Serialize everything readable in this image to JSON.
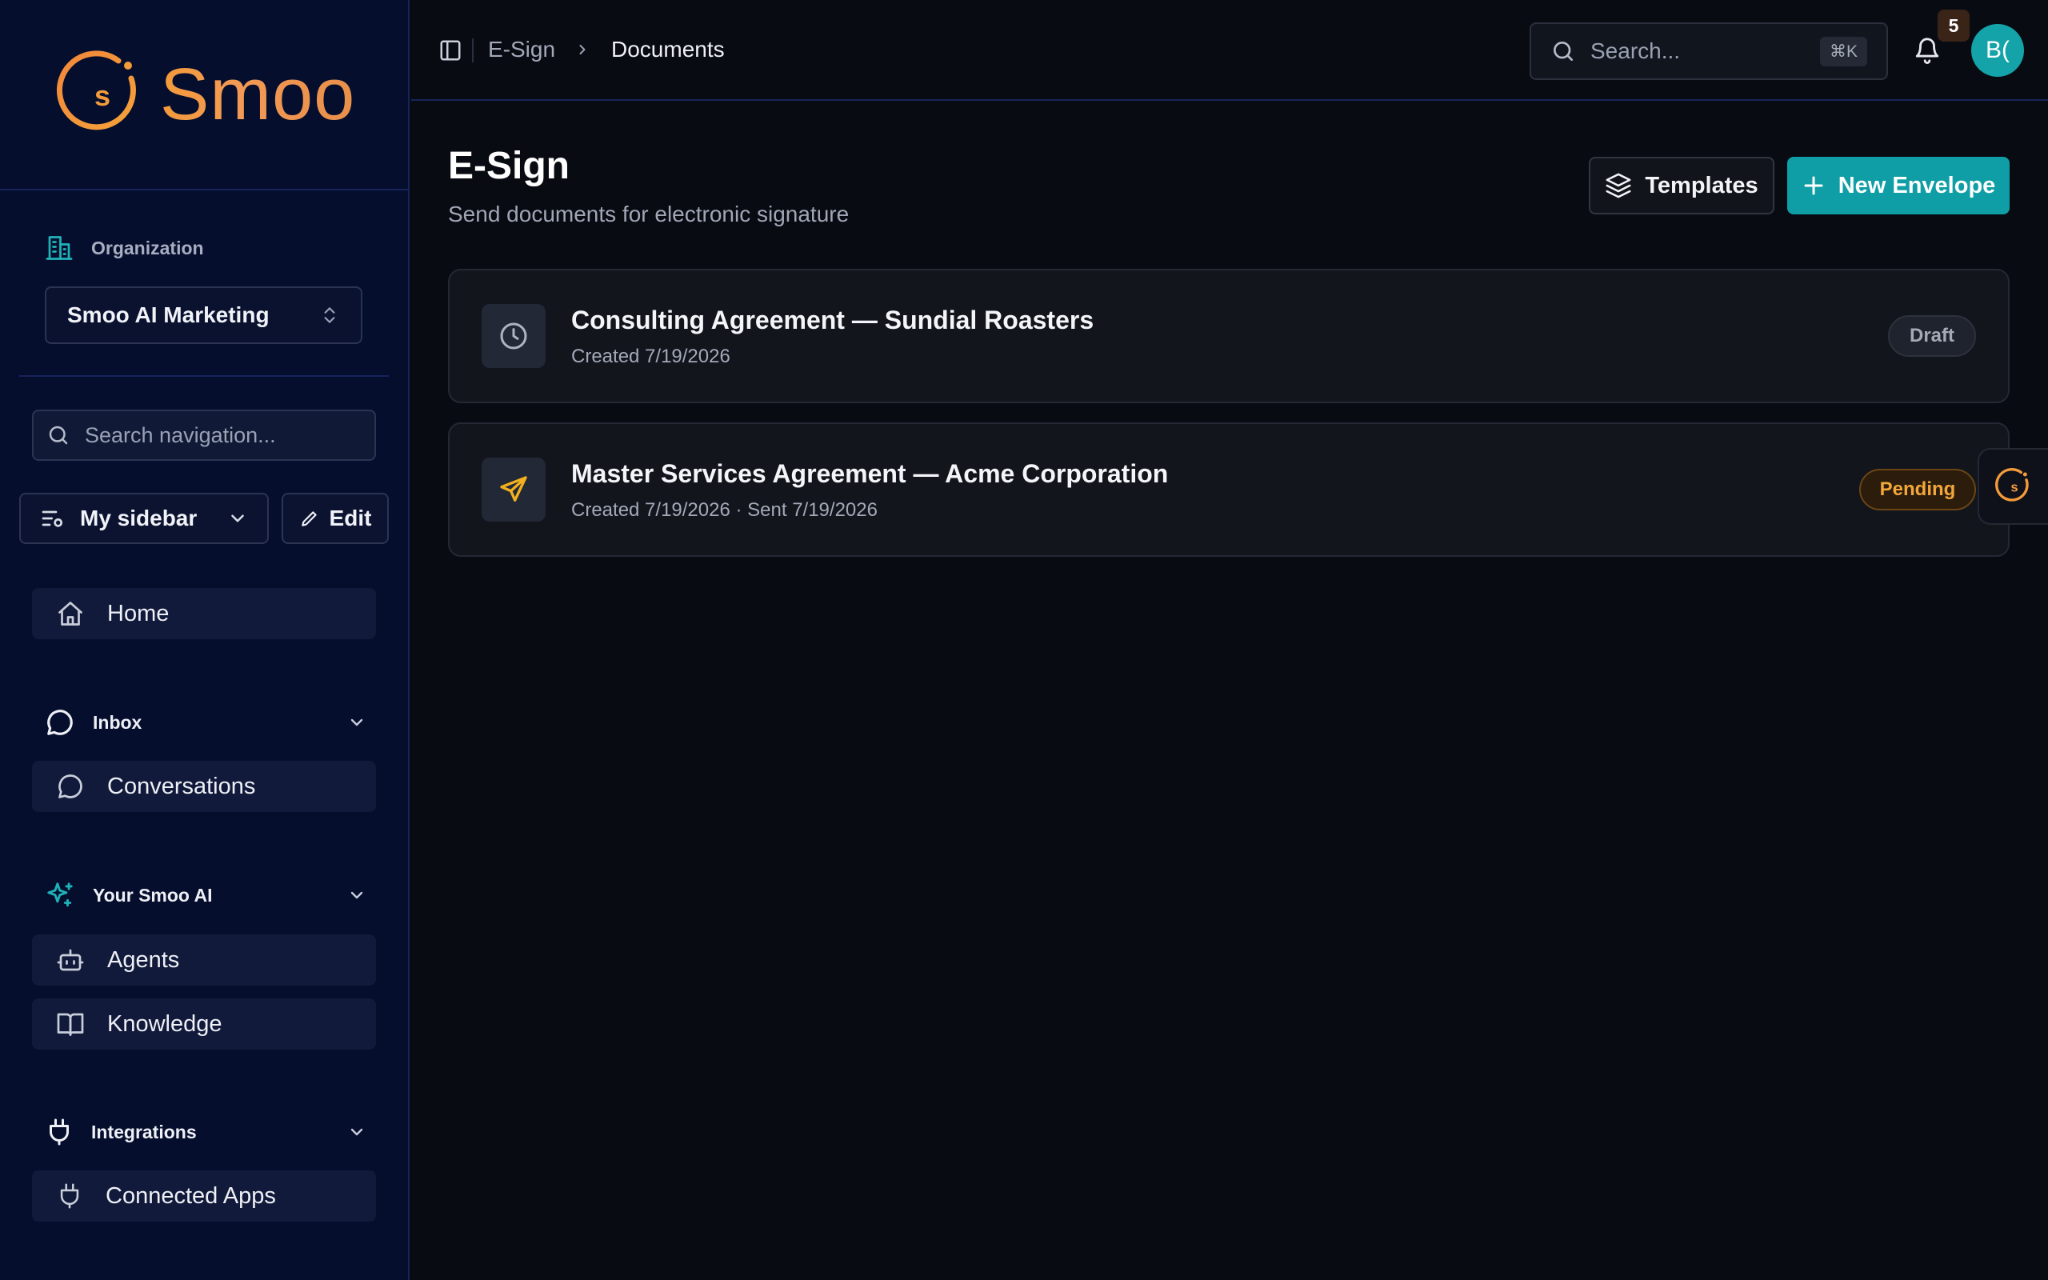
{
  "sidebar": {
    "logo_text": "Smoo",
    "organization_label": "Organization",
    "organization_name": "Smoo AI Marketing",
    "search_placeholder": "Search navigation...",
    "sidebar_view": "My sidebar",
    "edit_label": "Edit",
    "home_label": "Home",
    "sections": [
      {
        "label": "Inbox",
        "items": [
          "Conversations"
        ]
      },
      {
        "label": "Your Smoo AI",
        "items": [
          "Agents",
          "Knowledge"
        ]
      },
      {
        "label": "Integrations",
        "items": [
          "Connected Apps"
        ]
      }
    ]
  },
  "topbar": {
    "breadcrumb": [
      "E-Sign",
      "Documents"
    ],
    "search_placeholder": "Search...",
    "search_shortcut": "⌘K",
    "notification_count": "5",
    "avatar_initials": "B("
  },
  "main": {
    "title": "E-Sign",
    "subtitle": "Send documents for electronic signature",
    "templates_label": "Templates",
    "new_envelope_label": "New Envelope",
    "documents": [
      {
        "title": "Consulting Agreement — Sundial Roasters",
        "meta": "Created 7/19/2026",
        "status": "Draft",
        "icon": "clock-icon"
      },
      {
        "title": "Master Services Agreement — Acme Corporation",
        "meta": "Created 7/19/2026 · Sent 7/19/2026",
        "status": "Pending",
        "icon": "send-icon"
      }
    ]
  },
  "colors": {
    "accent": "#0f9ea5",
    "brand_orange": "#f39a3a",
    "pending": "#f3a63a",
    "sidebar_bg": "#060e2e",
    "page_bg": "#080b12"
  }
}
